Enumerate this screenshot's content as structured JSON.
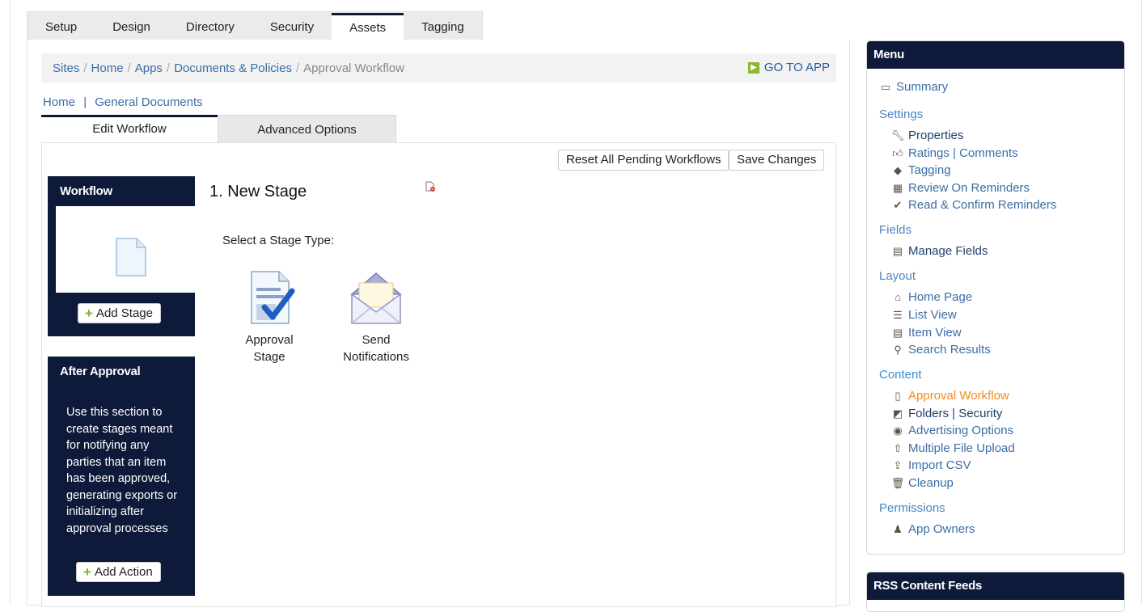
{
  "top_tabs": [
    "Setup",
    "Design",
    "Directory",
    "Security",
    "Assets",
    "Tagging"
  ],
  "active_top_tab": "Assets",
  "breadcrumb": {
    "sites": "Sites",
    "home": "Home",
    "apps": "Apps",
    "docs": "Documents & Policies",
    "current": "Approval Workflow",
    "sep": "/"
  },
  "go_to_app": "GO TO APP",
  "subnav": {
    "home": "Home",
    "pipe": "|",
    "general": "General Documents"
  },
  "inner_tabs": {
    "edit": "Edit Workflow",
    "advanced": "Advanced Options"
  },
  "buttons": {
    "reset": "Reset All Pending Workflows",
    "save": "Save Changes"
  },
  "workflow_box": {
    "title": "Workflow",
    "add_stage": "Add Stage"
  },
  "after_box": {
    "title": "After Approval",
    "text": "Use this section to create stages meant for notifying any parties that an item has been approved, generating exports or initializing after approval processes",
    "add_action": "Add Action"
  },
  "stage": {
    "title": "1. New Stage",
    "select_label": "Select a Stage Type:",
    "approval_line1": "Approval",
    "approval_line2": "Stage",
    "send_line1": "Send",
    "send_line2": "Notifications"
  },
  "menu": {
    "title": "Menu",
    "summary": "Summary",
    "settings": "Settings",
    "properties": "Properties",
    "ratings": "Ratings | Comments",
    "tagging": "Tagging",
    "review": "Review On Reminders",
    "read_confirm": "Read & Confirm Reminders",
    "fields": "Fields",
    "manage_fields": "Manage Fields",
    "layout": "Layout",
    "home_page": "Home Page",
    "list_view": "List View",
    "item_view": "Item View",
    "search_results": "Search Results",
    "content": "Content",
    "approval_workflow": "Approval Workflow",
    "folders": "Folders | Security",
    "advertising": "Advertising Options",
    "multi_upload": "Multiple File Upload",
    "import_csv": "Import CSV",
    "cleanup": "Cleanup",
    "permissions": "Permissions",
    "app_owners": "App Owners"
  },
  "rss": {
    "title": "RSS Content Feeds"
  },
  "colors": {
    "navy": "#0e1a3a",
    "link": "#3a6ea5",
    "accent_green": "#7ab32c",
    "active_orange": "#f28b1a"
  }
}
